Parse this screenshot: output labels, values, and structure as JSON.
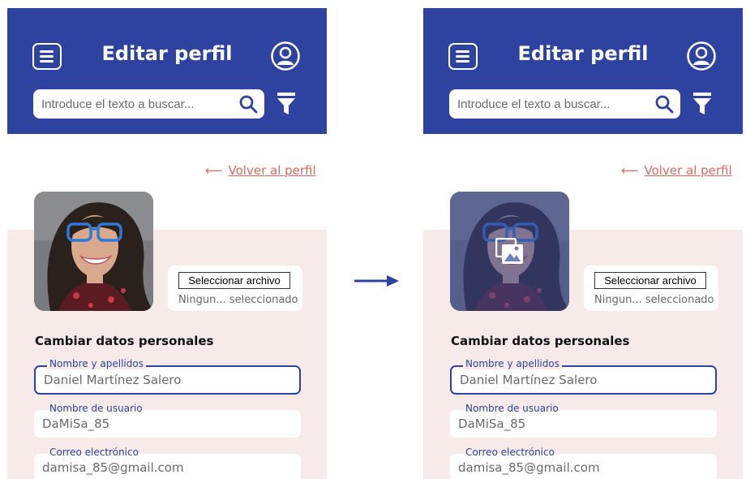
{
  "colors": {
    "header": "#2e43a0",
    "link": "#d9685e",
    "panel": "#f6ebe8",
    "overlay": "#3848969c"
  },
  "screens": [
    {
      "state": "default",
      "header": {
        "title": "Editar perfil",
        "menu_icon": "hamburger-menu-icon",
        "profile_icon": "user-account-icon"
      },
      "search": {
        "placeholder": "Introduce el texto a buscar...",
        "icon": "search-icon",
        "filter_icon": "filter-icon"
      },
      "back_link": "Volver al perfil",
      "upload": {
        "button_label": "Seleccionar archivo",
        "status": "Ningun... seleccionado"
      },
      "section_title": "Cambiar datos personales",
      "fields": [
        {
          "label": "Nombre y apellidos",
          "value": "Daniel Martínez Salero"
        },
        {
          "label": "Nombre de usuario",
          "value": "DaMiSa_85"
        },
        {
          "label": "Correo electrónico",
          "value": "damisa_85@gmail.com"
        }
      ]
    },
    {
      "state": "photo-hover",
      "header": {
        "title": "Editar perfil",
        "menu_icon": "hamburger-menu-icon",
        "profile_icon": "user-account-icon"
      },
      "search": {
        "placeholder": "Introduce el texto a buscar...",
        "icon": "search-icon",
        "filter_icon": "filter-icon"
      },
      "back_link": "Volver al perfil",
      "upload": {
        "button_label": "Seleccionar archivo",
        "status": "Ningun... seleccionado"
      },
      "section_title": "Cambiar datos personales",
      "fields": [
        {
          "label": "Nombre y apellidos",
          "value": "Daniel Martínez Salero"
        },
        {
          "label": "Nombre de usuario",
          "value": "DaMiSa_85"
        },
        {
          "label": "Correo electrónico",
          "value": "damisa_85@gmail.com"
        }
      ]
    }
  ]
}
